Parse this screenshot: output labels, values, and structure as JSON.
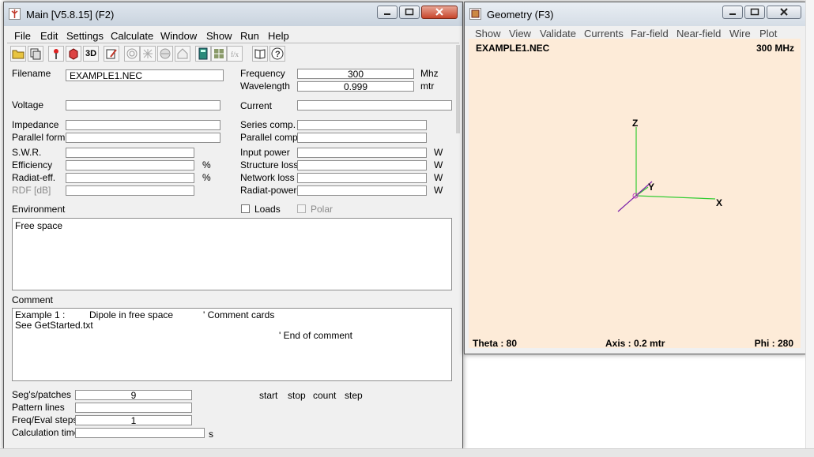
{
  "main_window": {
    "title": "Main [V5.8.15]  (F2)",
    "menu": [
      "File",
      "Edit",
      "Settings",
      "Calculate",
      "Window",
      "Show",
      "Run",
      "Help"
    ],
    "toolbar_icons": [
      "open-folder-icon",
      "copy-files-icon",
      "antenna-icon",
      "3d-box-icon",
      "3d-text-icon",
      "edit-icon",
      "pattern-icon",
      "far-field-icon",
      "near-field-icon",
      "house-icon",
      "calculator-icon",
      "grid-icon",
      "formula-icon",
      "book-icon",
      "help-icon"
    ],
    "toolbar_3d_text": "3D",
    "filename": {
      "label": "Filename",
      "value": "EXAMPLE1.NEC"
    },
    "frequency": {
      "label": "Frequency",
      "value": "300",
      "unit": "Mhz"
    },
    "wavelength": {
      "label": "Wavelength",
      "value": "0.999",
      "unit": "mtr"
    },
    "voltage": {
      "label": "Voltage",
      "value": ""
    },
    "current": {
      "label": "Current",
      "value": ""
    },
    "impedance": {
      "label": "Impedance",
      "value": ""
    },
    "series_comp": {
      "label": "Series comp.",
      "value": ""
    },
    "parallel_form": {
      "label": "Parallel form",
      "value": ""
    },
    "parallel_comp": {
      "label": "Parallel comp.",
      "value": ""
    },
    "swr": {
      "label": "S.W.R.",
      "value": ""
    },
    "efficiency": {
      "label": "Efficiency",
      "value": "",
      "unit": "%"
    },
    "radiat_eff": {
      "label": "Radiat-eff.",
      "value": "",
      "unit": "%"
    },
    "rdf": {
      "label": "RDF [dB]",
      "value": ""
    },
    "input_power": {
      "label": "Input power",
      "value": "",
      "unit": "W"
    },
    "structure_loss": {
      "label": "Structure loss",
      "value": "",
      "unit": "W"
    },
    "network_loss": {
      "label": "Network loss",
      "value": "",
      "unit": "W"
    },
    "radiat_power": {
      "label": "Radiat-power",
      "value": "",
      "unit": "W"
    },
    "environment": {
      "label": "Environment",
      "text": "Free space"
    },
    "loads": {
      "label": "Loads",
      "checked": false
    },
    "polar": {
      "label": "Polar",
      "checked": false,
      "disabled": true
    },
    "comment": {
      "label": "Comment",
      "line1a": "Example 1 :",
      "line1b": "Dipole in free space",
      "line1c": "' Comment cards",
      "line2": "See GetStarted.txt",
      "line3": "' End of comment"
    },
    "segs": {
      "label": "Seg's/patches",
      "value": "9"
    },
    "pattern_lines": {
      "label": "Pattern lines",
      "value": ""
    },
    "freq_eval": {
      "label": "Freq/Eval steps",
      "value": "1"
    },
    "calc_time": {
      "label": "Calculation time",
      "value": "",
      "unit": "s"
    },
    "column_headers": [
      "start",
      "stop",
      "count",
      "step"
    ]
  },
  "geometry_window": {
    "title": "Geometry     (F3)",
    "menu": [
      "Show",
      "View",
      "Validate",
      "Currents",
      "Far-field",
      "Near-field",
      "Wire",
      "Plot"
    ],
    "filename": "EXAMPLE1.NEC",
    "frequency": "300 MHz",
    "theta": "Theta : 80",
    "axis": "Axis : 0.2 mtr",
    "phi": "Phi : 280",
    "axis_labels": {
      "x": "X",
      "y": "Y",
      "z": "Z"
    },
    "colors": {
      "canvas": "#fdebd8",
      "z_axis": "#33cc33",
      "x_axis": "#33cc33",
      "y_axis": "#33cc33",
      "wire": "#7a1fa8"
    }
  }
}
